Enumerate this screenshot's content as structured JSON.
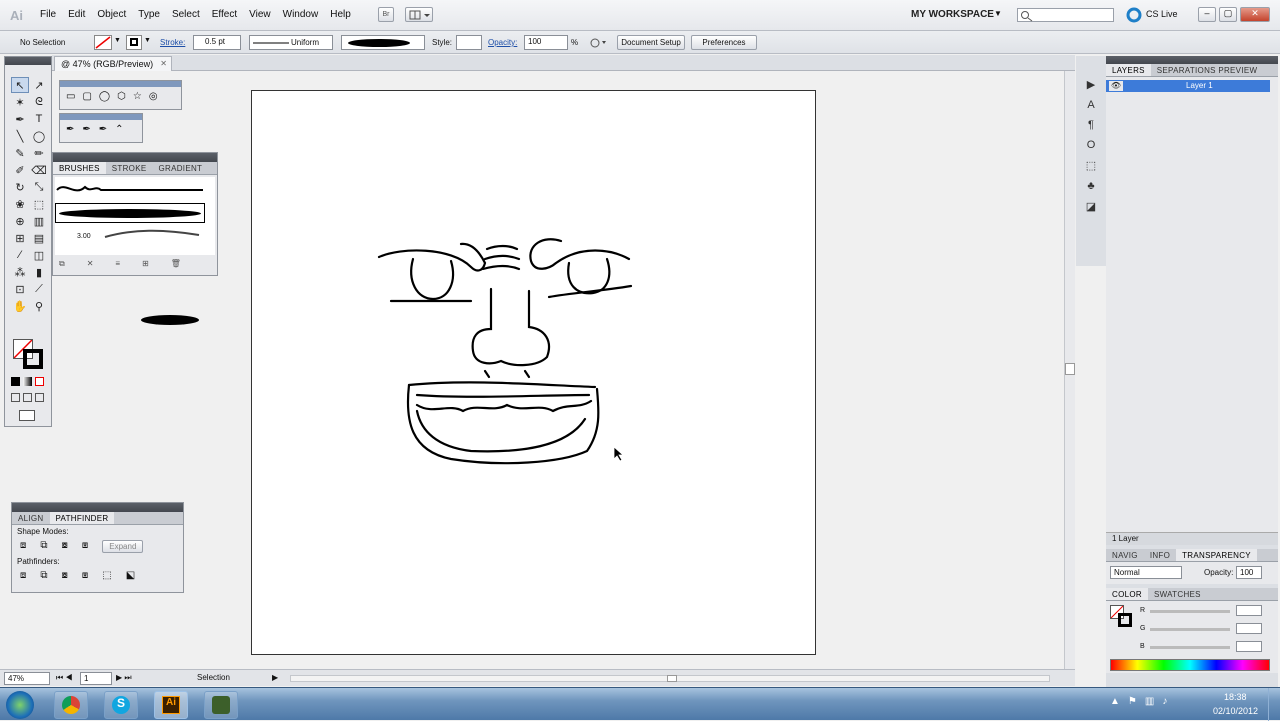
{
  "app": {
    "logo": "Ai",
    "workspace": "MY WORKSPACE",
    "cs_live": "CS Live",
    "bridge_label": "Br"
  },
  "menu": [
    "File",
    "Edit",
    "Object",
    "Type",
    "Select",
    "Effect",
    "View",
    "Window",
    "Help"
  ],
  "control": {
    "selection": "No Selection",
    "stroke_label": "Stroke:",
    "stroke_value": "0.5 pt",
    "profile": "Uniform",
    "style_label": "Style:",
    "opacity_label": "Opacity:",
    "opacity_value": "100",
    "opacity_unit": "%",
    "doc_setup": "Document Setup",
    "preferences": "Preferences"
  },
  "document": {
    "tab": "@ 47% (RGB/Preview)"
  },
  "brushes": {
    "tabs": [
      "BRUSHES",
      "STROKE",
      "GRADIENT"
    ],
    "brush_size": "3.00"
  },
  "pathfinder": {
    "tabs": [
      "ALIGN",
      "PATHFINDER"
    ],
    "shape_modes": "Shape Modes:",
    "pathfinders": "Pathfinders:",
    "expand": "Expand"
  },
  "layers": {
    "tabs": [
      "LAYERS",
      "SEPARATIONS PREVIEW"
    ],
    "layer_name": "Layer 1",
    "count": "1 Layer"
  },
  "transparency": {
    "tabs": [
      "NAVIG",
      "INFO",
      "TRANSPARENCY"
    ],
    "blend": "Normal",
    "opacity_label": "Opacity:",
    "opacity_value": "100"
  },
  "color": {
    "tabs": [
      "COLOR",
      "SWATCHES"
    ],
    "r": "R",
    "g": "G",
    "b": "B"
  },
  "status": {
    "zoom": "47%",
    "page": "1",
    "tool": "Selection"
  },
  "taskbar": {
    "time": "18:38",
    "date": "02/10/2012"
  }
}
